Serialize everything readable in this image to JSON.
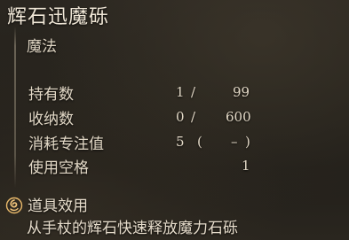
{
  "item": {
    "name": "辉石迅魔砾",
    "category": "魔法"
  },
  "stats": {
    "held": {
      "label": "持有数",
      "current": "1",
      "sep": "/",
      "max": "99"
    },
    "stored": {
      "label": "收纳数",
      "current": "0",
      "sep": "/",
      "max": "600"
    },
    "fp_cost": {
      "label": "消耗专注值",
      "value": "5",
      "open": "(",
      "dash": "–",
      "close": ")"
    },
    "slots": {
      "label": "使用空格",
      "value": "1"
    }
  },
  "effects": {
    "title": "道具效用",
    "icon": "swirl-effect-icon",
    "description": "从手杖的辉石快速释放魔力石砾"
  }
}
